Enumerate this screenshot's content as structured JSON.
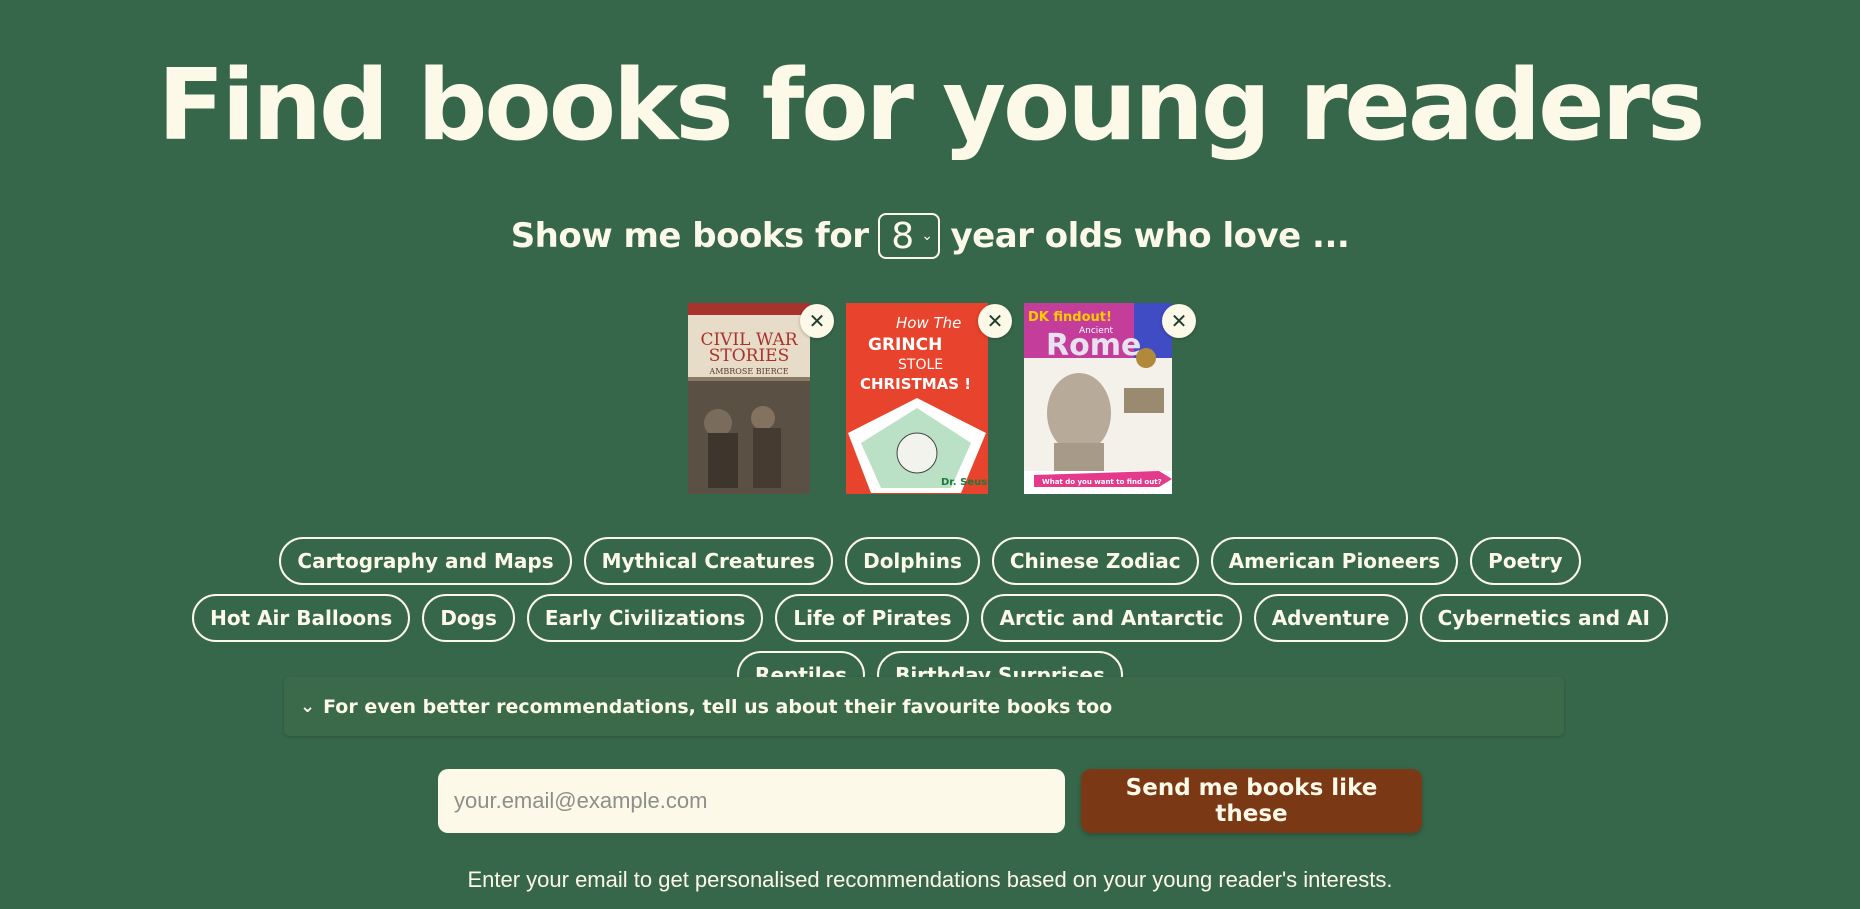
{
  "page": {
    "title": "Find books for young readers",
    "subtitle_before": "Show me books for",
    "age_value": "8",
    "subtitle_after": "year olds who love ..."
  },
  "books": [
    {
      "title": "Civil War Stories",
      "author": "Ambrose Bierce",
      "remove_icon": "close-icon",
      "cover_bg": "#8a7a66"
    },
    {
      "title": "How the Grinch Stole Christmas!",
      "author": "Dr. Seuss",
      "remove_icon": "close-icon",
      "cover_bg": "#e8432c"
    },
    {
      "title": "Ancient Rome",
      "author": "DK findout!",
      "remove_icon": "close-icon",
      "cover_bg": "#c43d9a"
    }
  ],
  "cover_text": {
    "book1_top": "CIVIL WAR",
    "book1_mid": "STORIES",
    "book1_author": "AMBROSE BIERCE",
    "book2_line1": "How The",
    "book2_line2": "GRINCH",
    "book2_line3": "STOLE",
    "book2_line4": "CHRISTMAS !",
    "book2_author": "Dr. Seuss",
    "book3_brand": "DK findout!",
    "book3_kicker": "Ancient",
    "book3_title": "Rome",
    "book3_banner": "What do you want to find out?"
  },
  "tags": [
    "Cartography and Maps",
    "Mythical Creatures",
    "Dolphins",
    "Chinese Zodiac",
    "American Pioneers",
    "Poetry",
    "Hot Air Balloons",
    "Dogs",
    "Early Civilizations",
    "Life of Pirates",
    "Arctic and Antarctic",
    "Adventure",
    "Cybernetics and AI",
    "Reptiles",
    "Birthday Surprises"
  ],
  "details": {
    "label": "For even better recommendations, tell us about their favourite books too",
    "icon": "chevron-down-icon"
  },
  "form": {
    "email_placeholder": "your.email@example.com",
    "email_value": "",
    "send_label": "Send me books like these"
  },
  "hint": "Enter your email to get personalised recommendations based on your young reader's interests.",
  "colors": {
    "background": "#37674a",
    "text": "#fdf9e8",
    "button": "#7a3914"
  }
}
